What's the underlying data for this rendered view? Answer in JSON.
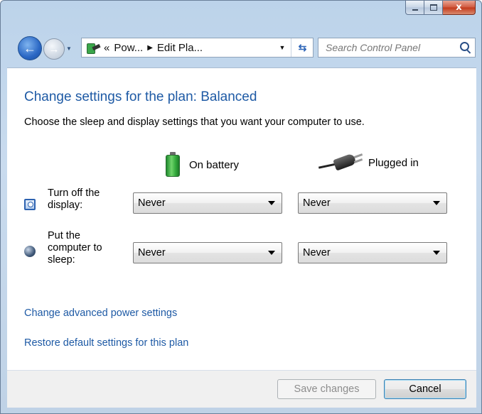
{
  "window": {
    "caption_buttons": {
      "minimize": "minimize",
      "maximize": "maximize",
      "close": "x"
    }
  },
  "nav": {
    "breadcrumb": [
      {
        "label": "«"
      },
      {
        "label": "Pow..."
      },
      {
        "label": "Edit Pla..."
      }
    ],
    "search_placeholder": "Search Control Panel"
  },
  "page": {
    "title": "Change settings for the plan: Balanced",
    "description": "Choose the sleep and display settings that you want your computer to use."
  },
  "columns": {
    "battery": "On battery",
    "plugged": "Plugged in"
  },
  "rows": {
    "display": {
      "label_lines": [
        "Turn off the",
        "display:"
      ],
      "battery_value": "Never",
      "plugged_value": "Never"
    },
    "sleep": {
      "label_lines": [
        "Put the",
        "computer to",
        "sleep:"
      ],
      "battery_value": "Never",
      "plugged_value": "Never"
    }
  },
  "links": {
    "advanced": "Change advanced power settings",
    "restore": "Restore default settings for this plan"
  },
  "buttons": {
    "save": "Save changes",
    "cancel": "Cancel"
  },
  "colors": {
    "link": "#1e5aa5",
    "title": "#1e5aa5",
    "close_button": "#c2381a"
  }
}
